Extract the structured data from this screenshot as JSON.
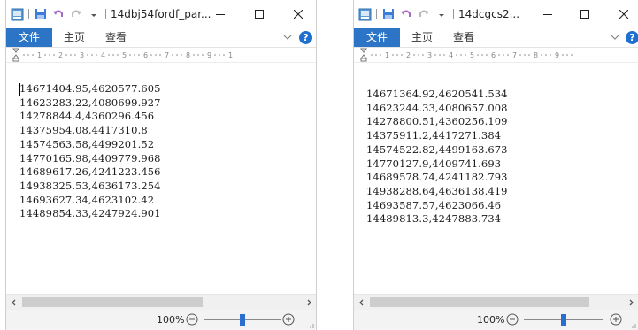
{
  "colors": {
    "accent": "#2b74c6",
    "zoom_thumb": "#2b6ed2",
    "help": "#1e6fd0"
  },
  "left": {
    "title": "14dbj54fordf_par...",
    "ribbon": {
      "file_tab": "文件",
      "home_tab": "主页",
      "view_tab": "查看",
      "help": "?"
    },
    "lines": [
      "14671404.95,4620577.605",
      "14623283.22,4080699.927",
      "14278844.4,4360296.456",
      "14375954.08,4417310.8",
      "14574563.58,4499201.52",
      "14770165.98,4409779.968",
      "14689617.26,4241223.456",
      "14938325.53,4636173.254",
      "14693627.34,4623102.42",
      "14489854.33,4247924.901"
    ],
    "zoom": "100%",
    "zoom_percent": 100
  },
  "right": {
    "title": "14dcgcs2...",
    "ribbon": {
      "file_tab": "文件",
      "home_tab": "主页",
      "view_tab": "查看",
      "help": "?"
    },
    "lines": [
      "14671364.92,4620541.534",
      "14623244.33,4080657.008",
      "14278800.51,4360256.109",
      "14375911.2,4417271.384",
      "14574522.82,4499163.673",
      "14770127.9,4409741.693",
      "14689578.74,4241182.793",
      "14938288.64,4636138.419",
      "14693587.57,4623066.46",
      "14489813.3,4247883.734"
    ],
    "zoom": "100%",
    "zoom_percent": 100
  },
  "ruler_numbers": [
    "1",
    "2",
    "3",
    "4",
    "5",
    "6",
    "7",
    "8",
    "9",
    "1"
  ],
  "icons": {
    "app": "wordpad-app-icon",
    "save": "save-icon",
    "undo": "undo-icon",
    "redo": "redo-icon",
    "customize": "customize-qat-icon",
    "minimize": "minimize-icon",
    "maximize": "maximize-icon",
    "close": "close-icon",
    "collapse": "chevron-down-icon",
    "zoom_out": "zoom-out-icon",
    "zoom_in": "zoom-in-icon"
  }
}
